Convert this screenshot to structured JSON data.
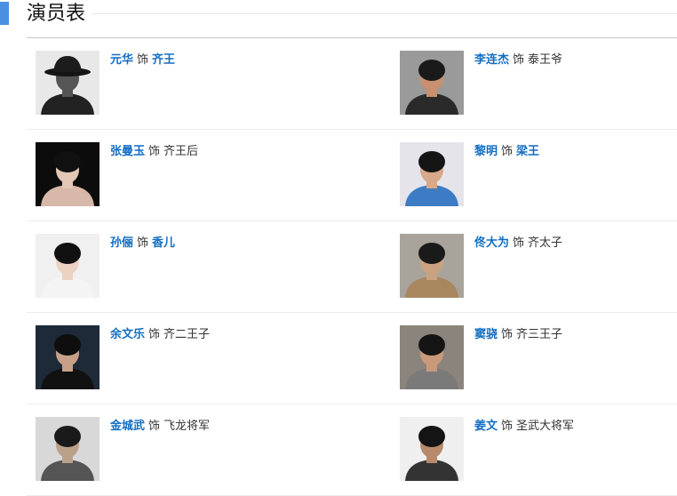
{
  "section": {
    "title": "演员表"
  },
  "cast": [
    {
      "actor": "元华",
      "sep": "饰",
      "role": "齐王",
      "role_linked": true,
      "photo": {
        "bg": "#e8e8e8",
        "skin": "#555555",
        "hair": "#111111",
        "shirt": "#222222",
        "hat": true
      }
    },
    {
      "actor": "李连杰",
      "sep": "饰",
      "role": "泰王爷",
      "role_linked": false,
      "photo": {
        "bg": "#9a9a9a",
        "skin": "#c89070",
        "hair": "#1a1a1a",
        "shirt": "#2a2a2a",
        "hat": false
      }
    },
    {
      "actor": "张曼玉",
      "sep": "饰",
      "role": "齐王后",
      "role_linked": false,
      "photo": {
        "bg": "#0c0c0c",
        "skin": "#e4c6b6",
        "hair": "#111111",
        "shirt": "#d8b8a8",
        "hat": false
      }
    },
    {
      "actor": "黎明",
      "sep": "饰",
      "role": "梁王",
      "role_linked": true,
      "photo": {
        "bg": "#e4e4ea",
        "skin": "#d8a888",
        "hair": "#151515",
        "shirt": "#3c7cc4",
        "hat": false
      }
    },
    {
      "actor": "孙俪",
      "sep": "饰",
      "role": "香儿",
      "role_linked": true,
      "photo": {
        "bg": "#f0f0f0",
        "skin": "#ecd2c2",
        "hair": "#111111",
        "shirt": "#f4f4f4",
        "hat": false
      }
    },
    {
      "actor": "佟大为",
      "sep": "饰",
      "role": "齐太子",
      "role_linked": false,
      "photo": {
        "bg": "#a8a49c",
        "skin": "#caa282",
        "hair": "#1a1a1a",
        "shirt": "#a8865e",
        "hat": false
      }
    },
    {
      "actor": "余文乐",
      "sep": "饰",
      "role": "齐二王子",
      "role_linked": false,
      "photo": {
        "bg": "#1e2a38",
        "skin": "#c8a088",
        "hair": "#0e0e0e",
        "shirt": "#111111",
        "hat": false
      }
    },
    {
      "actor": "窦骁",
      "sep": "饰",
      "role": "齐三王子",
      "role_linked": false,
      "photo": {
        "bg": "#8a847c",
        "skin": "#c89a7a",
        "hair": "#151515",
        "shirt": "#7a7a7a",
        "hat": false
      }
    },
    {
      "actor": "金城武",
      "sep": "饰",
      "role": "飞龙将军",
      "role_linked": false,
      "photo": {
        "bg": "#d8d8d8",
        "skin": "#bba08a",
        "hair": "#1a1a1a",
        "shirt": "#555555",
        "hat": false
      }
    },
    {
      "actor": "姜文",
      "sep": "饰",
      "role": "圣武大将军",
      "role_linked": false,
      "photo": {
        "bg": "#efefef",
        "skin": "#b88a6c",
        "hair": "#141414",
        "shirt": "#333333",
        "hat": false
      }
    }
  ]
}
